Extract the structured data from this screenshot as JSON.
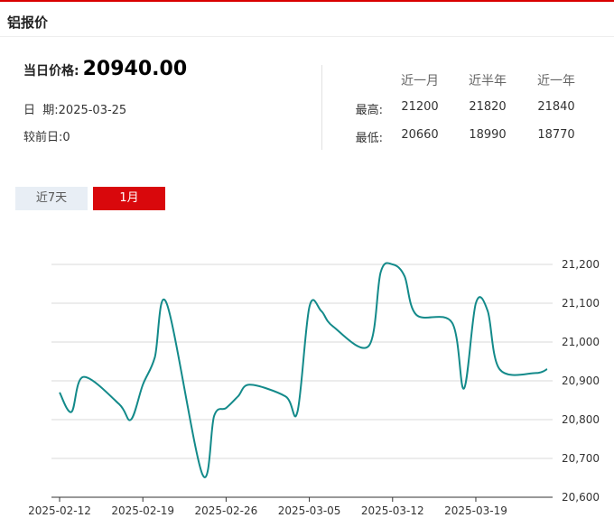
{
  "panel": {
    "title": "铝报价"
  },
  "price": {
    "label": "当日价格:",
    "value": "20940.00",
    "date_label": "日  期:",
    "date": "2025-03-25",
    "change_label": "较前日:",
    "change": "0"
  },
  "stats": {
    "headers": [
      "近一月",
      "近半年",
      "近一年"
    ],
    "rows": [
      {
        "label": "最高:",
        "values": [
          "21200",
          "21820",
          "21840"
        ]
      },
      {
        "label": "最低:",
        "values": [
          "20660",
          "18990",
          "18770"
        ]
      }
    ]
  },
  "tabs": [
    {
      "label": "近7天",
      "active": false
    },
    {
      "label": "1月",
      "active": true
    }
  ],
  "colors": {
    "accent": "#d9080c",
    "line": "#138a8a",
    "tab_inactive_bg": "#e8eef5"
  },
  "chart_data": {
    "type": "line",
    "x_tick_labels": [
      "2025-02-12",
      "2025-02-19",
      "2025-02-26",
      "2025-03-05",
      "2025-03-12",
      "2025-03-19"
    ],
    "y_tick_labels": [
      "20,600",
      "20,700",
      "20,800",
      "20,900",
      "21,000",
      "21,100",
      "21,200"
    ],
    "ylim": [
      20600,
      21200
    ],
    "grid": true,
    "series": [
      {
        "x": [
          "2025-02-12",
          "2025-02-13",
          "2025-02-14",
          "2025-02-17",
          "2025-02-18",
          "2025-02-19",
          "2025-02-20",
          "2025-02-21",
          "2025-02-24",
          "2025-02-25",
          "2025-02-26",
          "2025-02-27",
          "2025-02-28",
          "2025-03-03",
          "2025-03-04",
          "2025-03-05",
          "2025-03-06",
          "2025-03-07",
          "2025-03-10",
          "2025-03-11",
          "2025-03-12",
          "2025-03-13",
          "2025-03-14",
          "2025-03-17",
          "2025-03-18",
          "2025-03-19",
          "2025-03-20",
          "2025-03-21",
          "2025-03-24",
          "2025-03-25"
        ],
        "values": [
          20870,
          20820,
          20910,
          20840,
          20800,
          20890,
          20960,
          21100,
          20660,
          20810,
          20830,
          20860,
          20890,
          20860,
          20820,
          21090,
          21080,
          21040,
          20990,
          21180,
          21200,
          21170,
          21070,
          21050,
          20880,
          21100,
          21080,
          20930,
          20920,
          20930
        ]
      }
    ]
  }
}
